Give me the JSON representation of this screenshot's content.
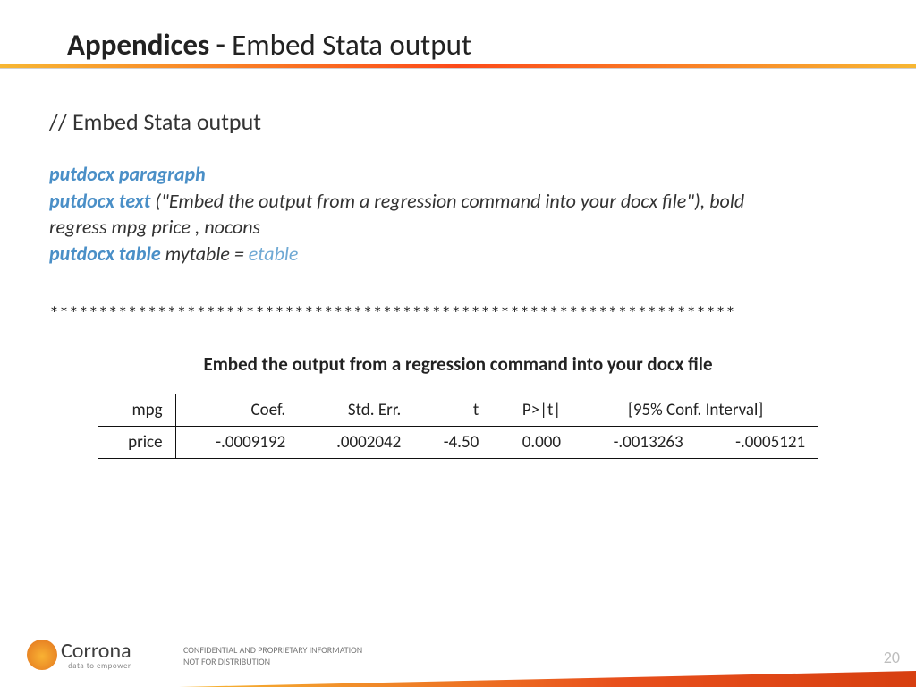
{
  "title": {
    "bold": "Appendices - ",
    "rest": "Embed Stata output"
  },
  "comment": "// Embed Stata output",
  "code": {
    "l1_kw": "putdocx paragraph",
    "l2_kw": "putdocx text",
    "l2_rest": " (\"Embed the output from a regression command into your docx file\"), bold",
    "l3": "regress mpg price , nocons",
    "l4_kw": "putdocx table",
    "l4_mid": " mytable = ",
    "l4_end": "etable"
  },
  "stars": "**********************************************************************",
  "table_title": "Embed the output from a regression command into your docx file",
  "headers": {
    "rlab": "mpg",
    "c1": "Coef.",
    "c2": "Std. Err.",
    "c3": "t",
    "c4": "P>|t|",
    "c5": "[95% Conf. Interval]"
  },
  "row": {
    "rlab": "price",
    "c1": "-.0009192",
    "c2": ".0002042",
    "c3": "-4.50",
    "c4": "0.000",
    "c5": "-.0013263",
    "c6": "-.0005121"
  },
  "footer": {
    "brand": "Corrona",
    "tag": "data to empower",
    "conf1": "CONFIDENTIAL AND PROPRIETARY INFORMATION",
    "conf2": "NOT FOR DISTRIBUTION",
    "page": "20"
  }
}
